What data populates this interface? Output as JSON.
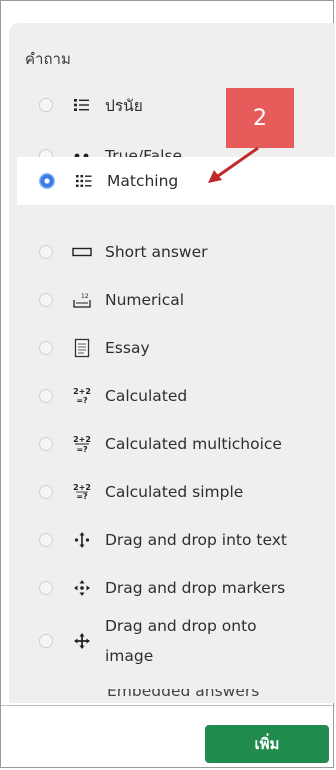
{
  "panel": {
    "section_label": "คำถาม",
    "items": [
      {
        "label": "ปรนัย",
        "icon": "list-icon",
        "selected": false
      },
      {
        "label": "True/False",
        "icon": "two-dots-icon",
        "selected": false
      },
      {
        "label": "Matching",
        "icon": "matching-list-icon",
        "selected": true
      },
      {
        "label": "Short answer",
        "icon": "rectangle-field-icon",
        "selected": false
      },
      {
        "label": "Numerical",
        "icon": "numeric-icon",
        "selected": false
      },
      {
        "label": "Essay",
        "icon": "document-icon",
        "selected": false
      },
      {
        "label": "Calculated",
        "icon": "formula-icon",
        "selected": false
      },
      {
        "label": "Calculated multichoice",
        "icon": "formula-icon",
        "selected": false
      },
      {
        "label": "Calculated simple",
        "icon": "formula-icon",
        "selected": false
      },
      {
        "label": "Drag and drop into text",
        "icon": "move-icon",
        "selected": false
      },
      {
        "label": "Drag and drop markers",
        "icon": "move-icon",
        "selected": false
      },
      {
        "label": "Drag and drop onto image",
        "icon": "move-icon",
        "selected": false
      },
      {
        "label": "Embedded answers",
        "icon": "embedded-icon",
        "selected": false
      }
    ],
    "icon_text": {
      "numeric": "12",
      "formula_top": "2+2",
      "formula_bottom": "=?"
    }
  },
  "footer": {
    "add_label": "เพิ่ม"
  },
  "annotation": {
    "callout_number": "2"
  },
  "colors": {
    "selected_radio": "#3a7de6",
    "add_button": "#1f8b4c",
    "callout": "#e85b5b",
    "arrow": "#c0282a"
  }
}
